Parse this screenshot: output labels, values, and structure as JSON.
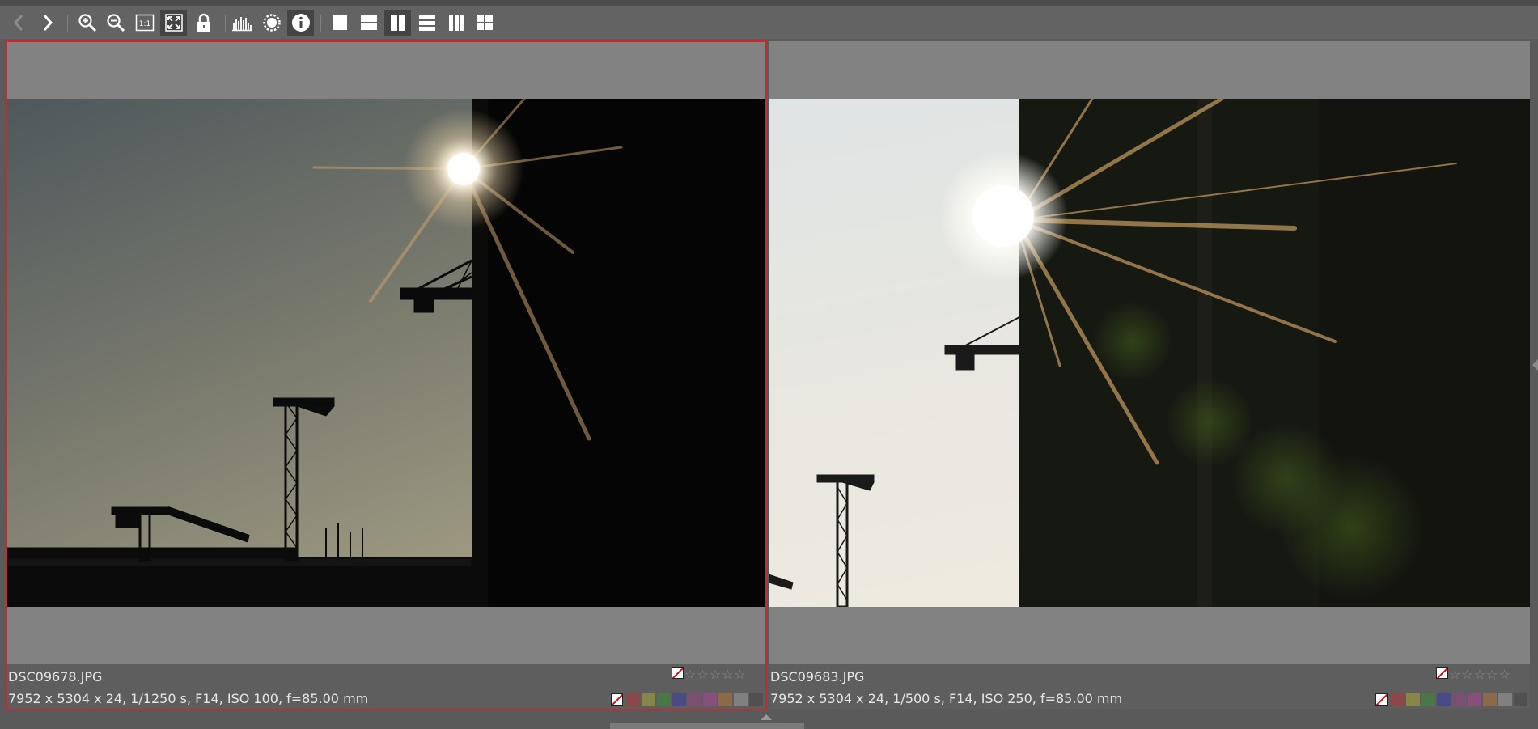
{
  "toolbar": {
    "icons": [
      "chevron-left-icon",
      "chevron-right-icon",
      "zoom-in-icon",
      "zoom-out-icon",
      "one-to-one-icon",
      "fit-to-screen-icon",
      "lock-icon",
      "histogram-icon",
      "brightness-icon",
      "info-icon",
      "layout-single-icon",
      "layout-two-rows-icon",
      "layout-two-columns-icon",
      "layout-three-rows-icon",
      "layout-three-columns-icon",
      "layout-grid-icon"
    ],
    "one_to_one_label": "1:1"
  },
  "panes": [
    {
      "filename": "DSC09678.JPG",
      "exif": "7952 x 5304 x 24, 1/1250 s, F14, ISO 100, f=85.00 mm",
      "rating_stars": "☆☆☆☆☆",
      "selected": true
    },
    {
      "filename": "DSC09683.JPG",
      "exif": "7952 x 5304 x 24, 1/500 s, F14, ISO 250, f=85.00 mm",
      "rating_stars": "☆☆☆☆☆",
      "selected": false
    }
  ],
  "color_labels": [
    "#8a4848",
    "#86864a",
    "#4a7648",
    "#4a4a86",
    "#7a5070",
    "#86507a",
    "#8a6a48",
    "#808080",
    "#505050"
  ],
  "colors": {
    "selection": "#d4242a",
    "toolbar": "#636363",
    "preview": "#828282"
  }
}
